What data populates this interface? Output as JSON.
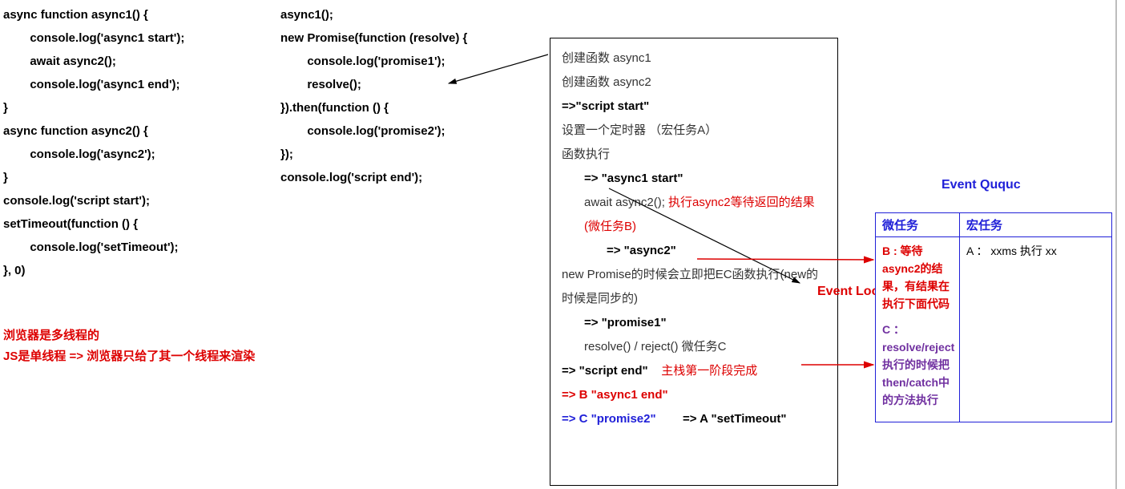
{
  "code1": "async function async1() {\n        console.log('async1 start');\n        await async2();\n        console.log('async1 end');\n}\nasync function async2() {\n        console.log('async2');\n}\nconsole.log('script start');\nsetTimeout(function () {\n        console.log('setTimeout');\n}, 0)",
  "code2": "async1();\nnew Promise(function (resolve) {\n        console.log('promise1');\n        resolve();\n}).then(function () {\n        console.log('promise2');\n});\nconsole.log('script end');",
  "notes": "浏览器是多线程的\nJS是单线程 => 浏览器只给了其一个线程来渲染",
  "flow": {
    "l1": "创建函数   async1",
    "l2": "创建函数   async2",
    "l3": "=>\"script start\"",
    "l4": "设置一个定时器  （宏任务A）",
    "l5": "函数执行",
    "l6": "=> \"async1 start\"",
    "l7a": "await async2(); ",
    "l7b": "执行async2等待返回的结果   (微任务B)",
    "l8": "=> \"async2\"",
    "l9": "new Promise的时候会立即把EC函数执行(new的时候是同步的)",
    "l10": "=> \"promise1\"",
    "l11": "resolve()  / reject()  微任务C",
    "l12a": "=>   \"script end\"",
    "l12b": "主栈第一阶段完成",
    "l13": "=> B \"async1 end\"",
    "l14a": "=> C  \"promise2\"",
    "l14b": "=> A   \"setTimeout\""
  },
  "eventloop": "Event\nLoop",
  "queue": {
    "title": "Event Ququc",
    "h1": "微任务",
    "h2": "宏任务",
    "micro_b": "B : 等待async2的结果，有结果在执行下面代码",
    "micro_c1": "C ：",
    "micro_c2": "resolve/reject执行的时候把then/catch中的方法执行",
    "macro_a": "A ： xxms 执行 xx"
  }
}
